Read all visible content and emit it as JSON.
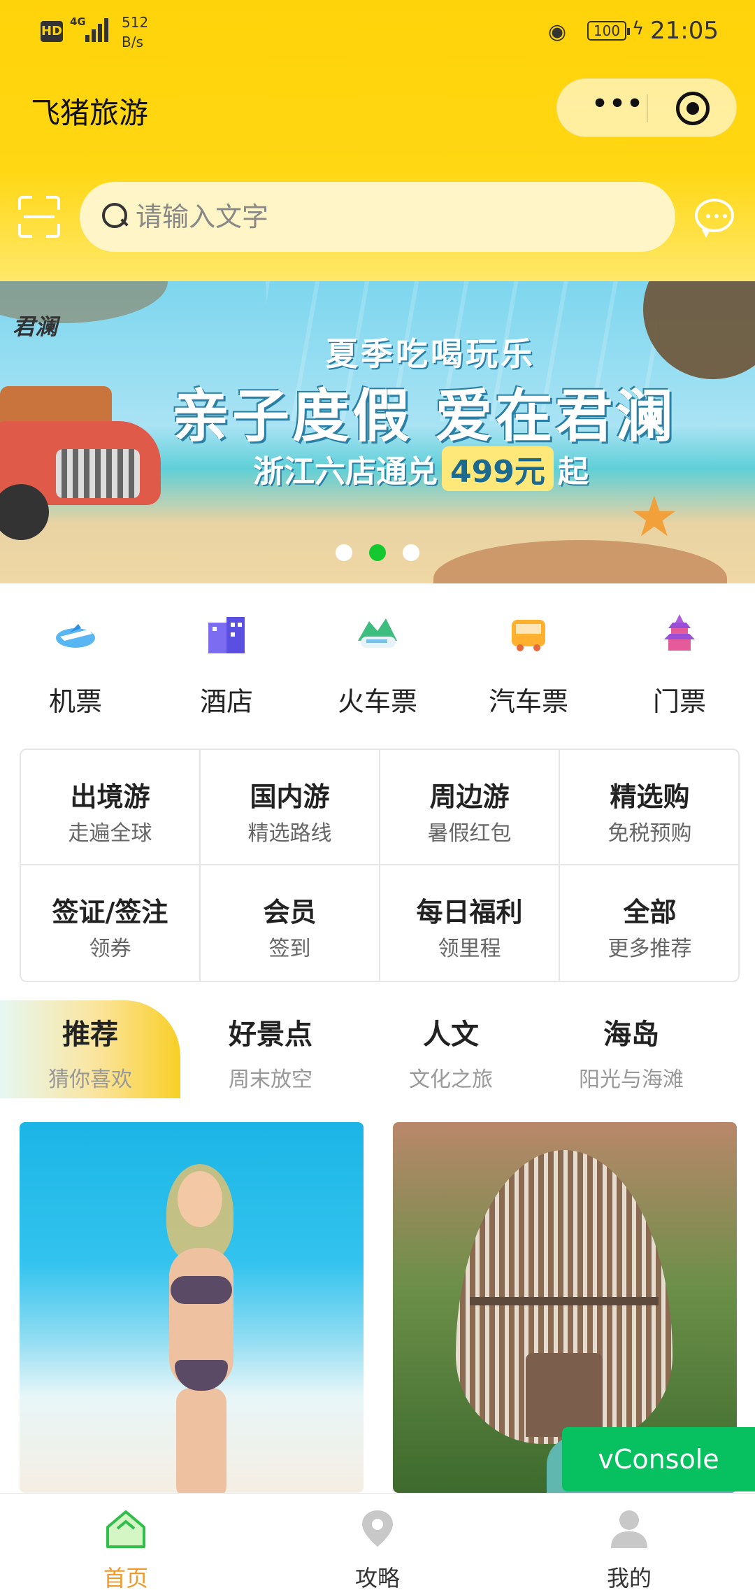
{
  "status_bar": {
    "hd": "HD",
    "network": "4G",
    "speed_value": "512",
    "speed_unit": "B/s",
    "battery": "100",
    "time": "21:05"
  },
  "header": {
    "title": "飞猪旅游",
    "more_icon": "more-dots-icon",
    "close_icon": "target-icon"
  },
  "search": {
    "placeholder": "请输入文字",
    "scan_icon": "scan-icon",
    "message_icon": "chat-bubble-icon"
  },
  "banner": {
    "brand": "君澜",
    "subtitle": "夏季吃喝玩乐",
    "headline": "亲子度假 爱在君澜",
    "offer_prefix": "浙江六店通兑",
    "offer_price": "499元",
    "offer_suffix": "起",
    "active_dot": 1,
    "dot_count": 3
  },
  "categories": [
    {
      "label": "机票",
      "icon": "plane-icon"
    },
    {
      "label": "酒店",
      "icon": "hotel-icon"
    },
    {
      "label": "火车票",
      "icon": "train-icon"
    },
    {
      "label": "汽车票",
      "icon": "bus-icon"
    },
    {
      "label": "门票",
      "icon": "temple-icon"
    }
  ],
  "grid": [
    {
      "title": "出境游",
      "sub": "走遍全球"
    },
    {
      "title": "国内游",
      "sub": "精选路线"
    },
    {
      "title": "周边游",
      "sub": "暑假红包"
    },
    {
      "title": "精选购",
      "sub": "免税预购"
    },
    {
      "title": "签证/签注",
      "sub": "领券"
    },
    {
      "title": "会员",
      "sub": "签到"
    },
    {
      "title": "每日福利",
      "sub": "领里程"
    },
    {
      "title": "全部",
      "sub": "更多推荐"
    }
  ],
  "tabs": [
    {
      "title": "推荐",
      "sub": "猜你喜欢"
    },
    {
      "title": "好景点",
      "sub": "周末放空"
    },
    {
      "title": "人文",
      "sub": "文化之旅"
    },
    {
      "title": "海岛",
      "sub": "阳光与海滩"
    }
  ],
  "floating": {
    "vconsole": "vConsole"
  },
  "tabbar": [
    {
      "label": "首页",
      "icon": "home-icon"
    },
    {
      "label": "攻略",
      "icon": "location-pin-icon"
    },
    {
      "label": "我的",
      "icon": "user-icon"
    }
  ],
  "colors": {
    "header_yellow": "#FFD30A",
    "active_green": "#14C92F",
    "tab_active_orange": "#F09A2E",
    "vconsole_green": "#07C160"
  }
}
